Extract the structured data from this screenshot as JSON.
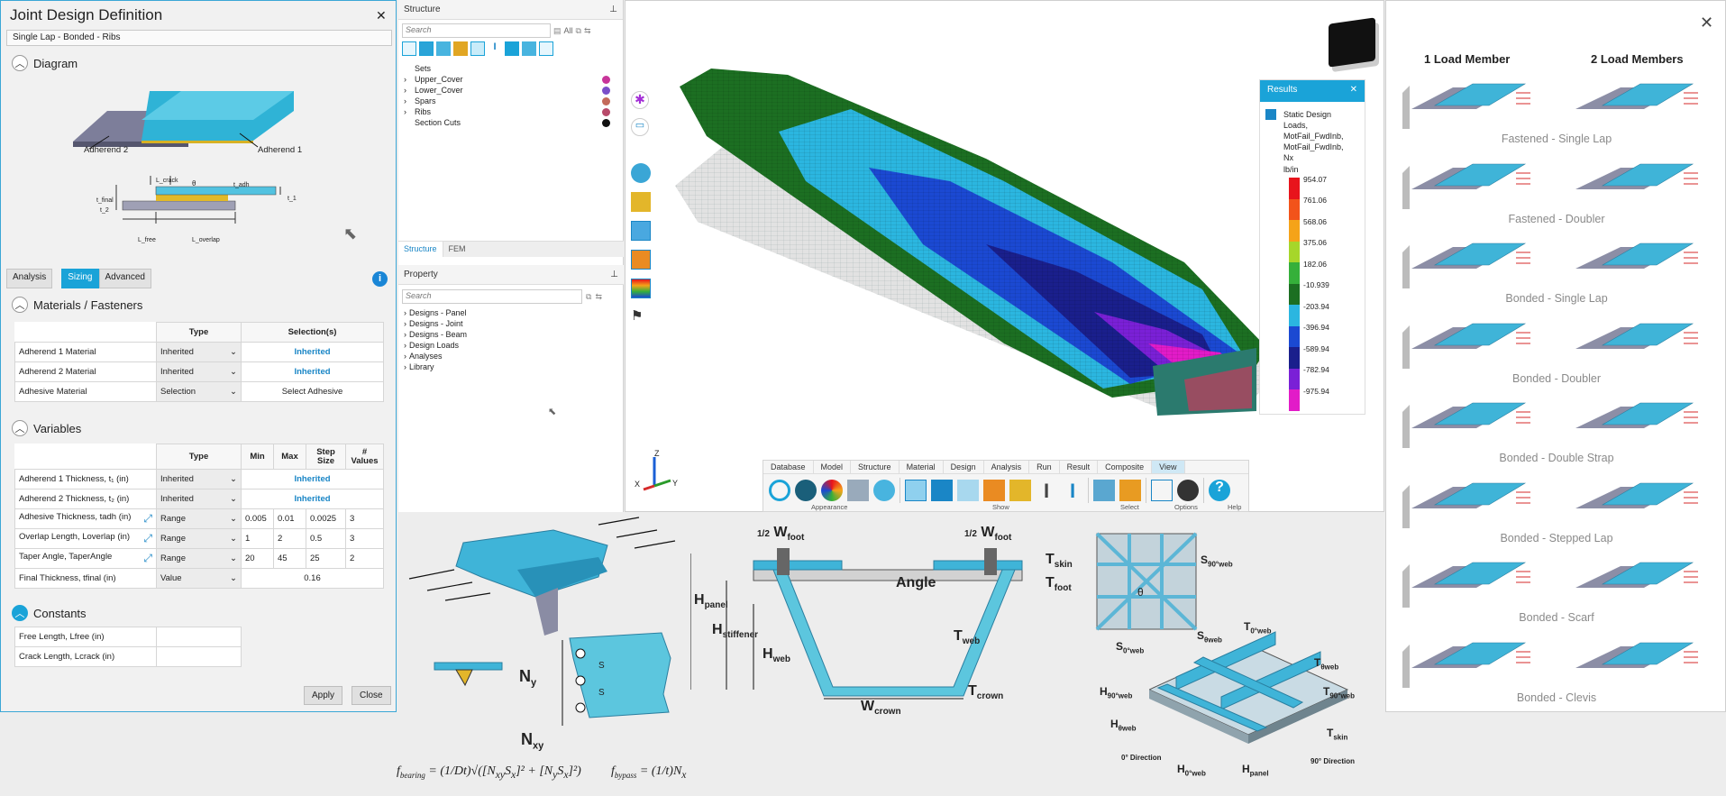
{
  "joint_panel": {
    "title": "Joint Design Definition",
    "subtitle": "Single Lap - Bonded - Ribs",
    "diagram_header": "Diagram",
    "adherend_labels": [
      "Adherend 2",
      "Adherend 1"
    ],
    "dim_labels": {
      "t_final": "t_final",
      "t2": "t_2",
      "t1": "t_1",
      "t_adh": "t_adh",
      "l_crack": "L_crack",
      "theta": "θ",
      "l_free": "L_free",
      "l_overlap": "L_overlap"
    },
    "tabs": [
      "Analysis",
      "Sizing",
      "Advanced"
    ],
    "selected_tab": "Sizing",
    "materials_header": "Materials / Fasteners",
    "materials_columns": [
      "",
      "Type",
      "Selection(s)"
    ],
    "materials_rows": [
      {
        "name": "Adherend 1 Material",
        "type": "Inherited",
        "selection": "Inherited"
      },
      {
        "name": "Adherend 2 Material",
        "type": "Inherited",
        "selection": "Inherited"
      },
      {
        "name": "Adhesive Material",
        "type": "Selection",
        "selection": "Select Adhesive"
      }
    ],
    "variables_header": "Variables",
    "variables_columns": [
      "",
      "Type",
      "Min",
      "Max",
      "Step Size",
      "# Values"
    ],
    "variables_rows": [
      {
        "name": "Adherend 1 Thickness, t₁ (in)",
        "type": "Inherited",
        "inherited": "Inherited"
      },
      {
        "name": "Adherend 2 Thickness, t₂ (in)",
        "type": "Inherited",
        "inherited": "Inherited"
      },
      {
        "name": "Adhesive Thickness, tadh (in)",
        "type": "Range",
        "min": "0.005",
        "max": "0.01",
        "step": "0.0025",
        "count": "3"
      },
      {
        "name": "Overlap Length, Loverlap (in)",
        "type": "Range",
        "min": "1",
        "max": "2",
        "step": "0.5",
        "count": "3"
      },
      {
        "name": "Taper Angle, TaperAngle",
        "type": "Range",
        "min": "20",
        "max": "45",
        "step": "25",
        "count": "2"
      },
      {
        "name": "Final Thickness, tfinal (in)",
        "type": "Value",
        "value": "0.16"
      }
    ],
    "constants_header": "Constants",
    "constants_rows": [
      "Free Length, Lfree (in)",
      "Crack Length, Lcrack (in)"
    ],
    "apply_label": "Apply",
    "close_label": "Close"
  },
  "structure_pane": {
    "title": "Structure",
    "search_placeholder": "Search",
    "all_label": "All",
    "tree": [
      {
        "label": "Sets",
        "color": ""
      },
      {
        "label": "Upper_Cover",
        "color": "#c8359a"
      },
      {
        "label": "Lower_Cover",
        "color": "#7a4fc9"
      },
      {
        "label": "Spars",
        "color": "#c46a5a"
      },
      {
        "label": "Ribs",
        "color": "#b84a6a"
      },
      {
        "label": "Section Cuts",
        "color": "#111111"
      }
    ],
    "bottom_tabs": [
      "Structure",
      "FEM"
    ]
  },
  "property_pane": {
    "title": "Property",
    "search_placeholder": "Search",
    "tree": [
      "Designs - Panel",
      "Designs - Joint",
      "Designs - Beam",
      "Design Loads",
      "Analyses",
      "Library"
    ]
  },
  "results": {
    "title": "Results",
    "description": "Static Design Loads, MotFail_FwdInb, MotFail_FwdInb, Nx",
    "unit": "lb/in",
    "legend": [
      {
        "value": "954.07",
        "color": "#e8141c"
      },
      {
        "value": "761.06",
        "color": "#f2531a"
      },
      {
        "value": "568.06",
        "color": "#f5a319"
      },
      {
        "value": "375.06",
        "color": "#a6d62a"
      },
      {
        "value": "182.06",
        "color": "#35b03a"
      },
      {
        "value": "-10.939",
        "color": "#1c6f22"
      },
      {
        "value": "-203.94",
        "color": "#2bb6e0"
      },
      {
        "value": "-396.94",
        "color": "#1b49d2"
      },
      {
        "value": "-589.94",
        "color": "#1a1f8c"
      },
      {
        "value": "-782.94",
        "color": "#7a20d6"
      },
      {
        "value": "-975.94",
        "color": "#e21bc8"
      }
    ]
  },
  "ribbon": {
    "tabs": [
      "Database",
      "Model",
      "Structure",
      "Material",
      "Design",
      "Analysis",
      "Run",
      "Result",
      "Composite",
      "View"
    ],
    "selected": "View",
    "groups": [
      "Appearance",
      "Show",
      "Select",
      "Options",
      "Help"
    ]
  },
  "axes": {
    "z": "Z",
    "x": "X",
    "y": "Y"
  },
  "library": {
    "col1": "1 Load Member",
    "col2": "2 Load Members",
    "items": [
      "Fastened - Single Lap",
      "Fastened - Doubler",
      "Bonded - Single Lap",
      "Bonded - Doubler",
      "Bonded - Double Strap",
      "Bonded - Stepped Lap",
      "Bonded - Scarf",
      "Bonded - Clevis"
    ]
  },
  "diagrams": {
    "ny": "N",
    "ny_sub": "y",
    "nxy": "N",
    "nxy_sub": "xy",
    "s": "S",
    "f_bearing": "f",
    "f_bearing_sub": "bearing",
    "f_bypass": "f",
    "f_bypass_sub": "bypass",
    "hat": {
      "w_foot": "W",
      "w_foot_sub": "foot",
      "half": "1/2",
      "t_skin": "T",
      "t_skin_sub": "skin",
      "t_foot": "T",
      "t_foot_sub": "foot",
      "angle": "Angle",
      "h_panel": "H",
      "h_panel_sub": "panel",
      "h_stiffener": "H",
      "h_stiffener_sub": "stiffener",
      "h_web": "H",
      "h_web_sub": "web",
      "t_web": "T",
      "t_web_sub": "web",
      "t_crown": "T",
      "t_crown_sub": "crown",
      "w_crown": "W",
      "w_crown_sub": "crown"
    },
    "grid": {
      "s90": "S",
      "s90_sub": "90°web",
      "theta": "θ",
      "s0": "S",
      "s0_sub": "0°web",
      "stheta": "S",
      "stheta_sub": "θweb",
      "t0": "T",
      "t0_sub": "0°web",
      "ttheta": "T",
      "ttheta_sub": "θweb",
      "t90": "T",
      "t90_sub": "90°web",
      "h90": "H",
      "h90_sub": "90°web",
      "htheta": "H",
      "htheta_sub": "θweb",
      "h0": "H",
      "h0_sub": "0°web",
      "hpanel": "H",
      "hpanel_sub": "panel",
      "tskin": "T",
      "tskin_sub": "skin",
      "dir0": "0° Direction",
      "dir90": "90° Direction"
    }
  }
}
